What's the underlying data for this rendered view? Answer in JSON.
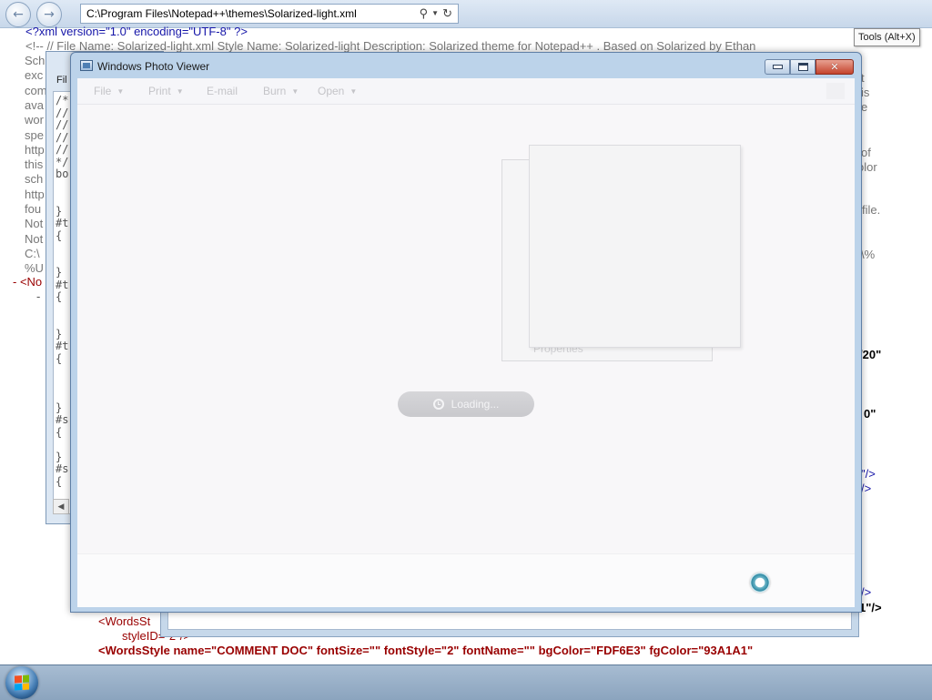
{
  "browser": {
    "address": "C:\\Program Files\\Notepad++\\themes\\Solarized-light.xml",
    "tooltip": "Tools (Alt+X)"
  },
  "xml": {
    "line1": "<?xml version=\"1.0\" encoding=\"UTF-8\" ?>",
    "line2": "<!-- // File Name: Solarized-light.xml Style Name: Solarized-light Description: Solarized theme for Notepad++ . Based on Solarized by Ethan",
    "left_fragments": [
      "Sch",
      "exc",
      "com",
      "ava",
      "wor",
      "spe",
      "http",
      "this",
      "sch",
      "http",
      "fou",
      "Not",
      "Not",
      "C:\\",
      "%U"
    ],
    "right_fragments": [
      "t",
      "is",
      "e",
      "of",
      "olor",
      "file.",
      "\\%"
    ],
    "node_open": "- <No",
    "node_child": "-",
    "right_values": [
      "/20\"",
      "0\"",
      "\"/>",
      "/>",
      "/>",
      "1\"/>"
    ],
    "words_style_1a": "<WordsSt",
    "words_style_1b": "styleID=\"2\"/>",
    "words_style_2": "<WordsStyle name=\"COMMENT DOC\" fontSize=\"\" fontStyle=\"2\" fontName=\"\" bgColor=\"FDF6E3\" fgColor=\"93A1A1\""
  },
  "notepad": {
    "menu_fragment": "Fil",
    "editor_lines": [
      "/*",
      "//",
      "//",
      "//",
      "//",
      "*/",
      "bo",
      "",
      "",
      "}",
      "#t",
      "{",
      "",
      "",
      "}",
      "#t",
      "{",
      "",
      "",
      "}",
      "#t",
      "{",
      "",
      "",
      "",
      "}",
      "#s",
      "{",
      "",
      "}",
      "#s",
      "{"
    ]
  },
  "photo_viewer": {
    "title": "Windows Photo Viewer",
    "toolbar": [
      {
        "label": "File",
        "has_arrow": true
      },
      {
        "label": "Print",
        "has_arrow": true
      },
      {
        "label": "E-mail",
        "has_arrow": false
      },
      {
        "label": "Burn",
        "has_arrow": true
      },
      {
        "label": "Open",
        "has_arrow": true
      }
    ],
    "ghost_label": "Properties",
    "loading_text": "Loading..."
  },
  "icons": {
    "back": "arrow-left-icon",
    "forward": "arrow-right-icon",
    "search": "search-icon",
    "refresh": "refresh-icon",
    "app": "photo-viewer-app-icon",
    "minimize": "minimize-icon",
    "maximize": "maximize-icon",
    "close": "close-icon",
    "busy": "busy-spinner-icon",
    "start": "windows-start-icon",
    "clock": "clock-icon"
  },
  "colors": {
    "close_button": "#c4432c",
    "xml_tag": "#1515a8",
    "xml_attr": "#990000"
  }
}
